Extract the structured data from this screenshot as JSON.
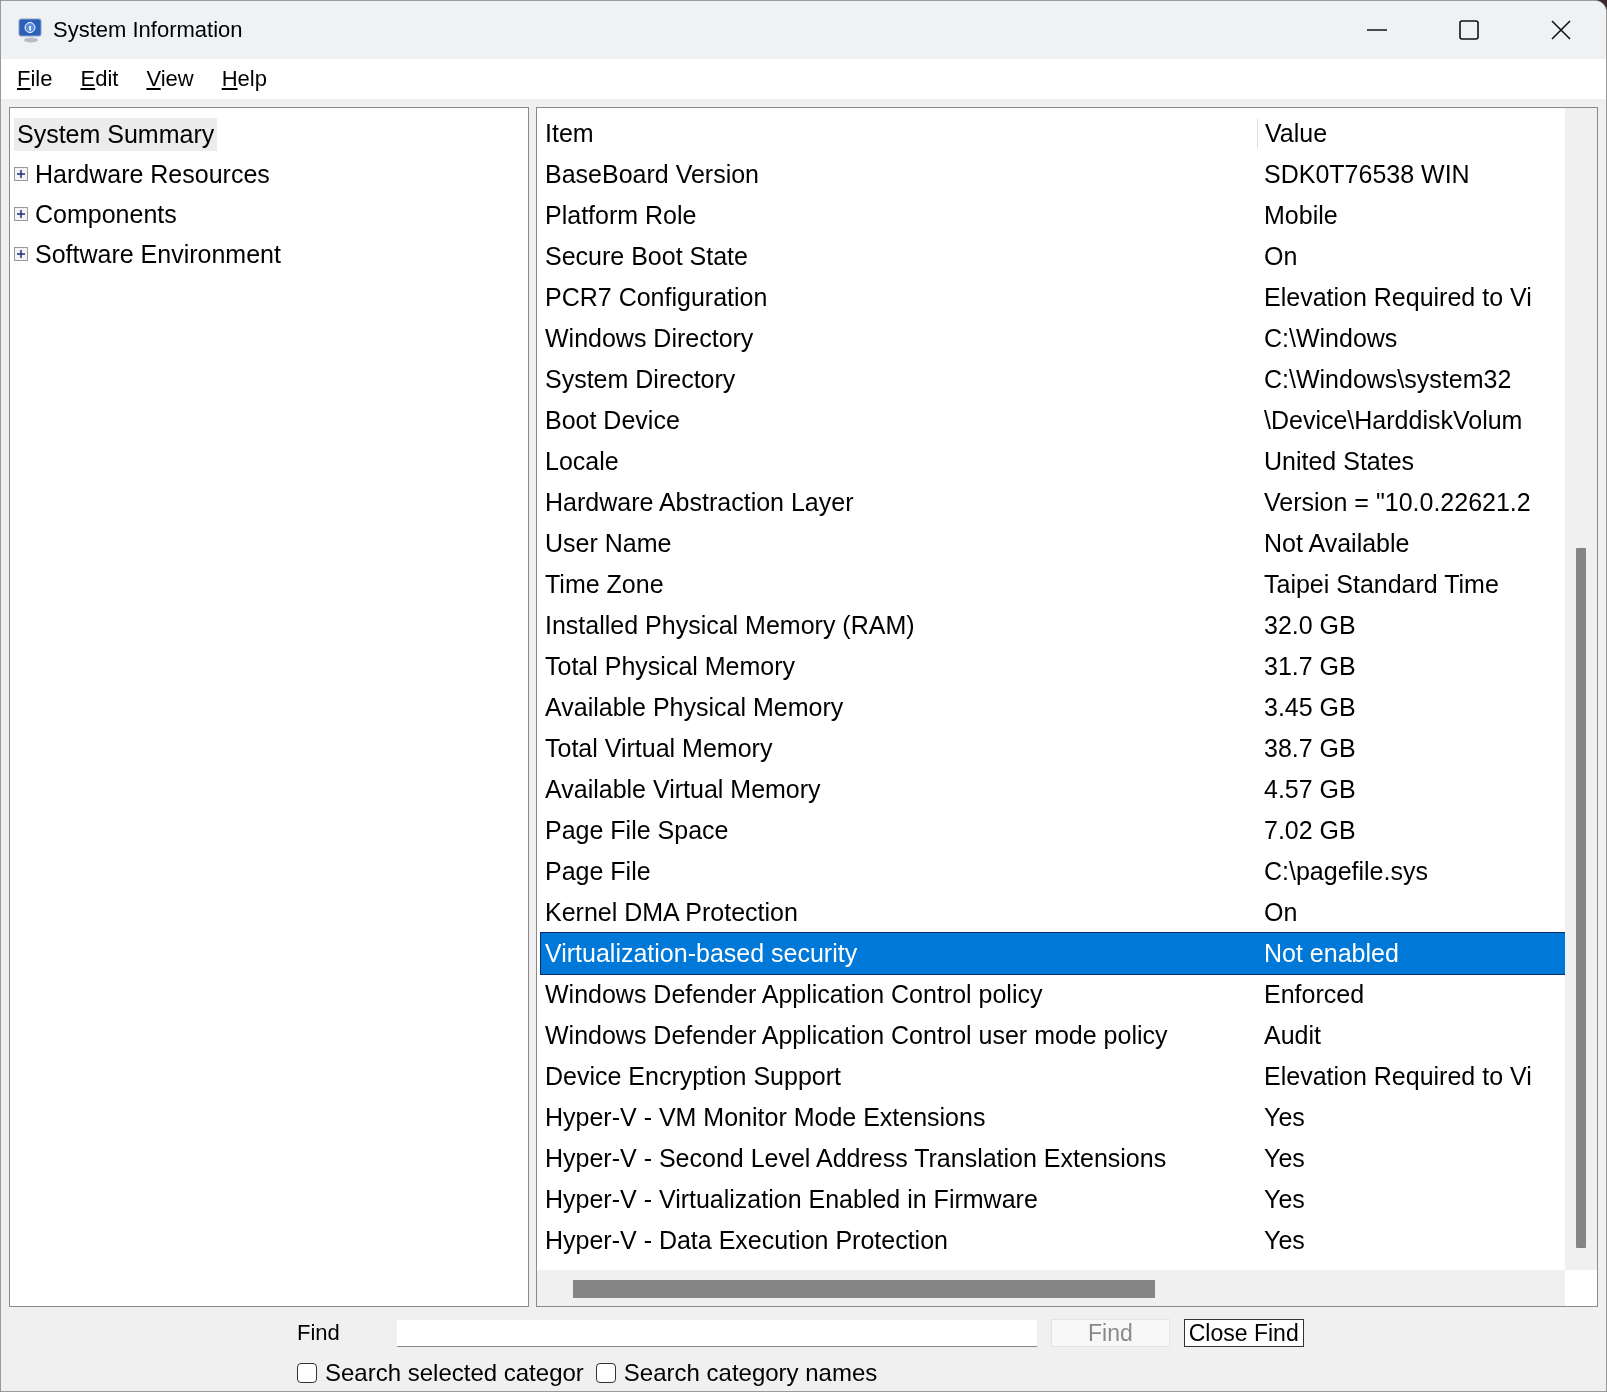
{
  "window": {
    "title": "System Information"
  },
  "menu": [
    "File",
    "Edit",
    "View",
    "Help"
  ],
  "tree": [
    {
      "label": "System Summary",
      "kind": "leaf",
      "selected": true
    },
    {
      "label": "Hardware Resources",
      "kind": "branch",
      "selected": false,
      "expanded": false
    },
    {
      "label": "Components",
      "kind": "branch",
      "selected": false,
      "expanded": false
    },
    {
      "label": "Software Environment",
      "kind": "branch",
      "selected": false,
      "expanded": false
    }
  ],
  "table": {
    "columns": [
      "Item",
      "Value"
    ],
    "rows": [
      {
        "item": "BaseBoard Version",
        "value": "SDK0T76538 WIN",
        "selected": false
      },
      {
        "item": "Platform Role",
        "value": "Mobile",
        "selected": false
      },
      {
        "item": "Secure Boot State",
        "value": "On",
        "selected": false
      },
      {
        "item": "PCR7 Configuration",
        "value": "Elevation Required to Vi",
        "selected": false
      },
      {
        "item": "Windows Directory",
        "value": "C:\\Windows",
        "selected": false
      },
      {
        "item": "System Directory",
        "value": "C:\\Windows\\system32",
        "selected": false
      },
      {
        "item": "Boot Device",
        "value": "\\Device\\HarddiskVolum",
        "selected": false
      },
      {
        "item": "Locale",
        "value": "United States",
        "selected": false
      },
      {
        "item": "Hardware Abstraction Layer",
        "value": "Version = \"10.0.22621.2",
        "selected": false
      },
      {
        "item": "User Name",
        "value": "Not Available",
        "selected": false
      },
      {
        "item": "Time Zone",
        "value": "Taipei Standard Time",
        "selected": false
      },
      {
        "item": "Installed Physical Memory (RAM)",
        "value": "32.0 GB",
        "selected": false
      },
      {
        "item": "Total Physical Memory",
        "value": "31.7 GB",
        "selected": false
      },
      {
        "item": "Available Physical Memory",
        "value": "3.45 GB",
        "selected": false
      },
      {
        "item": "Total Virtual Memory",
        "value": "38.7 GB",
        "selected": false
      },
      {
        "item": "Available Virtual Memory",
        "value": "4.57 GB",
        "selected": false
      },
      {
        "item": "Page File Space",
        "value": "7.02 GB",
        "selected": false
      },
      {
        "item": "Page File",
        "value": "C:\\pagefile.sys",
        "selected": false
      },
      {
        "item": "Kernel DMA Protection",
        "value": "On",
        "selected": false
      },
      {
        "item": "Virtualization-based security",
        "value": "Not enabled",
        "selected": true
      },
      {
        "item": "Windows Defender Application Control policy",
        "value": "Enforced",
        "selected": false
      },
      {
        "item": "Windows Defender Application Control user mode policy",
        "value": "Audit",
        "selected": false
      },
      {
        "item": "Device Encryption Support",
        "value": "Elevation Required to Vi",
        "selected": false
      },
      {
        "item": "Hyper-V - VM Monitor Mode Extensions",
        "value": "Yes",
        "selected": false
      },
      {
        "item": "Hyper-V - Second Level Address Translation Extensions",
        "value": "Yes",
        "selected": false
      },
      {
        "item": "Hyper-V - Virtualization Enabled in Firmware",
        "value": "Yes",
        "selected": false
      },
      {
        "item": "Hyper-V - Data Execution Protection",
        "value": "Yes",
        "selected": false
      }
    ]
  },
  "find": {
    "label": "Find",
    "find_button": {
      "label": "Find",
      "disabled": true
    },
    "close_button": {
      "label": "Close Find",
      "disabled": false
    },
    "options": [
      {
        "label": "Search selected categor",
        "checked": false
      },
      {
        "label": "Search category names",
        "checked": false
      }
    ]
  }
}
